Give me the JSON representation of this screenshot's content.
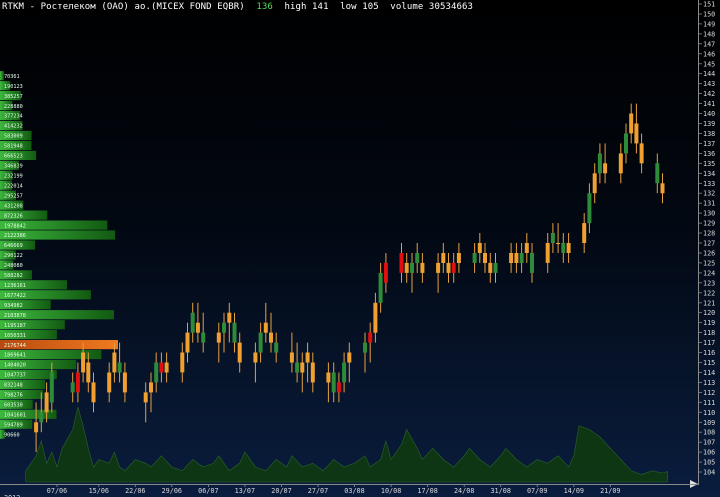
{
  "header": {
    "title": "RTKM - Ростелеком (ОАО) ао.(MICEX FOND EQBR)",
    "last": "136",
    "high": "high 141",
    "low": "low 105",
    "volume": "volume 30534663"
  },
  "colors": {
    "up_candle": "#f0a030",
    "down_candle": "#2e8b3a",
    "signal_candle": "#e01010",
    "profile_bar": "#1f8a1f",
    "profile_max": "#e06010",
    "volume_area": "#0f3a10",
    "axis_text": "#d8d8d8"
  },
  "chart_data": {
    "type": "candlestick",
    "ylim": [
      103,
      151
    ],
    "y_ticks": [
      104,
      105,
      106,
      107,
      108,
      109,
      110,
      111,
      112,
      113,
      114,
      115,
      116,
      117,
      118,
      119,
      120,
      121,
      122,
      123,
      124,
      125,
      126,
      127,
      128,
      129,
      130,
      131,
      132,
      133,
      134,
      135,
      136,
      137,
      138,
      139,
      140,
      141,
      142,
      143,
      144,
      145,
      146,
      147,
      148,
      149,
      150,
      151
    ],
    "x_tick_labels": [
      "07/06",
      "15/06",
      "22/06",
      "29/06",
      "06/07",
      "13/07",
      "20/07",
      "27/07",
      "03/08",
      "10/08",
      "17/08",
      "24/08",
      "31/08",
      "07/09",
      "14/09",
      "21/09"
    ],
    "x_tick_days": [
      0,
      8,
      15,
      22,
      29,
      36,
      43,
      50,
      57,
      64,
      71,
      78,
      85,
      92,
      99,
      106
    ],
    "first_label_partial": "2012",
    "prices": [
      [
        -4,
        108,
        111,
        106,
        109,
        "up"
      ],
      [
        -3,
        109,
        112,
        108,
        110,
        "down"
      ],
      [
        -2,
        110,
        113,
        109,
        112,
        "up"
      ],
      [
        -1,
        111,
        115,
        110,
        114,
        "down"
      ],
      [
        3,
        113,
        114,
        111,
        112,
        "down"
      ],
      [
        4,
        112,
        115,
        111,
        114,
        "signal"
      ],
      [
        5,
        114,
        117,
        113,
        116,
        "up"
      ],
      [
        6,
        115,
        116,
        112,
        113,
        "up"
      ],
      [
        7,
        113,
        114,
        110,
        111,
        "up"
      ],
      [
        10,
        112,
        115,
        111,
        114,
        "up"
      ],
      [
        11,
        114,
        117,
        113,
        116,
        "up"
      ],
      [
        12,
        115,
        117,
        113,
        114,
        "down"
      ],
      [
        13,
        114,
        115,
        111,
        112,
        "up"
      ],
      [
        17,
        111,
        113,
        109,
        112,
        "up"
      ],
      [
        18,
        112,
        114,
        110,
        113,
        "up"
      ],
      [
        19,
        113,
        116,
        112,
        115,
        "down"
      ],
      [
        20,
        114,
        116,
        113,
        115,
        "signal"
      ],
      [
        21,
        115,
        116,
        113,
        114,
        "up"
      ],
      [
        24,
        114,
        117,
        113,
        116,
        "up"
      ],
      [
        25,
        116,
        119,
        115,
        118,
        "up"
      ],
      [
        26,
        118,
        121,
        117,
        120,
        "down"
      ],
      [
        27,
        119,
        121,
        117,
        118,
        "up"
      ],
      [
        28,
        118,
        120,
        116,
        117,
        "down"
      ],
      [
        31,
        117,
        119,
        115,
        118,
        "up"
      ],
      [
        32,
        118,
        120,
        116,
        119,
        "down"
      ],
      [
        33,
        119,
        121,
        117,
        120,
        "up"
      ],
      [
        34,
        119,
        120,
        116,
        117,
        "down"
      ],
      [
        35,
        117,
        118,
        114,
        115,
        "up"
      ],
      [
        38,
        115,
        117,
        113,
        116,
        "up"
      ],
      [
        39,
        116,
        119,
        115,
        118,
        "down"
      ],
      [
        40,
        118,
        121,
        117,
        119,
        "up"
      ],
      [
        41,
        118,
        120,
        116,
        117,
        "up"
      ],
      [
        42,
        117,
        118,
        115,
        116,
        "down"
      ],
      [
        45,
        116,
        118,
        114,
        115,
        "up"
      ],
      [
        46,
        115,
        117,
        113,
        114,
        "down"
      ],
      [
        47,
        114,
        116,
        112,
        115,
        "up"
      ],
      [
        48,
        115,
        117,
        113,
        116,
        "up"
      ],
      [
        49,
        115,
        116,
        112,
        113,
        "up"
      ],
      [
        52,
        113,
        115,
        111,
        114,
        "up"
      ],
      [
        53,
        114,
        115,
        111,
        112,
        "down"
      ],
      [
        54,
        112,
        114,
        111,
        113,
        "signal"
      ],
      [
        55,
        113,
        116,
        112,
        115,
        "down"
      ],
      [
        56,
        115,
        117,
        113,
        116,
        "up"
      ],
      [
        59,
        116,
        118,
        114,
        117,
        "down"
      ],
      [
        60,
        117,
        119,
        115,
        118,
        "signal"
      ],
      [
        61,
        118,
        122,
        117,
        121,
        "up"
      ],
      [
        62,
        121,
        125,
        120,
        124,
        "down"
      ],
      [
        63,
        123,
        126,
        122,
        125,
        "signal"
      ],
      [
        66,
        124,
        127,
        123,
        126,
        "signal"
      ],
      [
        67,
        125,
        126,
        123,
        124,
        "up"
      ],
      [
        68,
        124,
        126,
        122,
        125,
        "down"
      ],
      [
        69,
        125,
        127,
        124,
        126,
        "down"
      ],
      [
        70,
        125,
        126,
        123,
        124,
        "up"
      ],
      [
        73,
        124,
        126,
        122,
        125,
        "up"
      ],
      [
        74,
        125,
        127,
        124,
        126,
        "up"
      ],
      [
        75,
        125,
        126,
        123,
        124,
        "up"
      ],
      [
        76,
        124,
        126,
        123,
        125,
        "signal"
      ],
      [
        77,
        125,
        127,
        124,
        126,
        "up"
      ],
      [
        80,
        125,
        127,
        124,
        126,
        "down"
      ],
      [
        81,
        126,
        128,
        125,
        127,
        "up"
      ],
      [
        82,
        126,
        127,
        124,
        125,
        "up"
      ],
      [
        83,
        125,
        126,
        123,
        124,
        "up"
      ],
      [
        84,
        124,
        126,
        123,
        125,
        "down"
      ],
      [
        87,
        125,
        127,
        124,
        126,
        "up"
      ],
      [
        88,
        126,
        127,
        124,
        125,
        "up"
      ],
      [
        89,
        125,
        127,
        124,
        126,
        "down"
      ],
      [
        90,
        126,
        128,
        125,
        127,
        "up"
      ],
      [
        91,
        126,
        127,
        123,
        124,
        "down"
      ],
      [
        94,
        125,
        128,
        124,
        127,
        "up"
      ],
      [
        95,
        127,
        129,
        126,
        128,
        "down"
      ],
      [
        96,
        127,
        129,
        126,
        127,
        "up"
      ],
      [
        97,
        127,
        128,
        125,
        126,
        "down"
      ],
      [
        98,
        126,
        128,
        125,
        127,
        "up"
      ],
      [
        101,
        127,
        130,
        126,
        129,
        "up"
      ],
      [
        102,
        129,
        133,
        128,
        132,
        "down"
      ],
      [
        103,
        132,
        135,
        131,
        134,
        "up"
      ],
      [
        104,
        134,
        137,
        133,
        136,
        "down"
      ],
      [
        105,
        135,
        137,
        133,
        134,
        "up"
      ],
      [
        108,
        134,
        137,
        133,
        136,
        "up"
      ],
      [
        109,
        136,
        139,
        135,
        138,
        "down"
      ],
      [
        110,
        138,
        141,
        137,
        140,
        "up"
      ],
      [
        111,
        139,
        141,
        136,
        137,
        "up"
      ],
      [
        112,
        137,
        138,
        134,
        135,
        "up"
      ],
      [
        115,
        135,
        136,
        132,
        133,
        "down"
      ],
      [
        116,
        133,
        134,
        131,
        132,
        "up"
      ]
    ],
    "volume_profile": [
      {
        "price": 143.8,
        "label": "70361",
        "value": 70361
      },
      {
        "price": 142.8,
        "label": "190123",
        "value": 190123
      },
      {
        "price": 141.8,
        "label": "385257",
        "value": 385257
      },
      {
        "price": 140.8,
        "label": "228880",
        "value": 228880
      },
      {
        "price": 139.8,
        "label": "377234",
        "value": 377234
      },
      {
        "price": 138.8,
        "label": "414232",
        "value": 414232
      },
      {
        "price": 137.8,
        "label": "583009",
        "value": 583009
      },
      {
        "price": 136.8,
        "label": "581948",
        "value": 581948
      },
      {
        "price": 135.8,
        "label": "666523",
        "value": 666523
      },
      {
        "price": 134.8,
        "label": "346839",
        "value": 346839
      },
      {
        "price": 133.8,
        "label": "232199",
        "value": 232199
      },
      {
        "price": 132.8,
        "label": "222014",
        "value": 222014
      },
      {
        "price": 131.8,
        "label": "295257",
        "value": 295257
      },
      {
        "price": 130.8,
        "label": "431208",
        "value": 431208
      },
      {
        "price": 129.8,
        "label": "872326",
        "value": 872326
      },
      {
        "price": 128.8,
        "label": "1978842",
        "value": 1978842
      },
      {
        "price": 127.8,
        "label": "2122386",
        "value": 2122386
      },
      {
        "price": 126.8,
        "label": "646669",
        "value": 646669
      },
      {
        "price": 125.8,
        "label": "290122",
        "value": 290122
      },
      {
        "price": 124.8,
        "label": "248080",
        "value": 248080
      },
      {
        "price": 123.8,
        "label": "588282",
        "value": 588282
      },
      {
        "price": 122.8,
        "label": "1236161",
        "value": 1236161
      },
      {
        "price": 121.8,
        "label": "1677422",
        "value": 1677422
      },
      {
        "price": 120.8,
        "label": "934982",
        "value": 934982
      },
      {
        "price": 119.8,
        "label": "2103878",
        "value": 2103878
      },
      {
        "price": 118.8,
        "label": "1195187",
        "value": 1195187
      },
      {
        "price": 117.8,
        "label": "1050331",
        "value": 1050331
      },
      {
        "price": 116.8,
        "label": "2176744",
        "value": 2176744,
        "max": true
      },
      {
        "price": 115.8,
        "label": "1869641",
        "value": 1869641
      },
      {
        "price": 114.8,
        "label": "1404020",
        "value": 1404020
      },
      {
        "price": 113.8,
        "label": "1047737",
        "value": 1047737
      },
      {
        "price": 112.8,
        "label": "832148",
        "value": 832148
      },
      {
        "price": 111.8,
        "label": "798276",
        "value": 798276
      },
      {
        "price": 110.8,
        "label": "603530",
        "value": 603530
      },
      {
        "price": 109.8,
        "label": "1041601",
        "value": 1041601
      },
      {
        "price": 108.8,
        "label": "594789",
        "value": 594789
      },
      {
        "price": 107.8,
        "label": "90660",
        "value": 90660
      }
    ],
    "volume_series": [
      [
        -6,
        0.15
      ],
      [
        -4,
        0.35
      ],
      [
        -3,
        0.55
      ],
      [
        -2,
        0.25
      ],
      [
        -1,
        0.4
      ],
      [
        0,
        0.2
      ],
      [
        1,
        0.45
      ],
      [
        3,
        0.7
      ],
      [
        4,
        1.0
      ],
      [
        5,
        0.75
      ],
      [
        6,
        0.45
      ],
      [
        7,
        0.2
      ],
      [
        8,
        0.3
      ],
      [
        10,
        0.25
      ],
      [
        11,
        0.4
      ],
      [
        12,
        0.2
      ],
      [
        13,
        0.15
      ],
      [
        15,
        0.3
      ],
      [
        17,
        0.25
      ],
      [
        18,
        0.2
      ],
      [
        20,
        0.35
      ],
      [
        22,
        0.2
      ],
      [
        24,
        0.15
      ],
      [
        26,
        0.3
      ],
      [
        28,
        0.2
      ],
      [
        30,
        0.25
      ],
      [
        31,
        0.35
      ],
      [
        33,
        0.15
      ],
      [
        35,
        0.25
      ],
      [
        36,
        0.4
      ],
      [
        38,
        0.2
      ],
      [
        40,
        0.15
      ],
      [
        42,
        0.3
      ],
      [
        44,
        0.2
      ],
      [
        45,
        0.35
      ],
      [
        47,
        0.2
      ],
      [
        49,
        0.25
      ],
      [
        51,
        0.15
      ],
      [
        53,
        0.3
      ],
      [
        55,
        0.2
      ],
      [
        57,
        0.25
      ],
      [
        59,
        0.35
      ],
      [
        60,
        0.2
      ],
      [
        62,
        0.3
      ],
      [
        63,
        0.55
      ],
      [
        64,
        0.3
      ],
      [
        66,
        0.5
      ],
      [
        67,
        0.7
      ],
      [
        69,
        0.45
      ],
      [
        70,
        0.3
      ],
      [
        72,
        0.45
      ],
      [
        74,
        0.3
      ],
      [
        76,
        0.2
      ],
      [
        78,
        0.35
      ],
      [
        79,
        0.45
      ],
      [
        81,
        0.3
      ],
      [
        83,
        0.2
      ],
      [
        85,
        0.35
      ],
      [
        86,
        0.45
      ],
      [
        88,
        0.3
      ],
      [
        90,
        0.2
      ],
      [
        92,
        0.3
      ],
      [
        94,
        0.25
      ],
      [
        96,
        0.35
      ],
      [
        98,
        0.2
      ],
      [
        99,
        0.35
      ],
      [
        100,
        0.75
      ],
      [
        102,
        0.7
      ],
      [
        104,
        0.6
      ],
      [
        106,
        0.45
      ],
      [
        108,
        0.3
      ],
      [
        110,
        0.15
      ],
      [
        112,
        0.1
      ],
      [
        114,
        0.15
      ],
      [
        116,
        0.12
      ],
      [
        117,
        0.14
      ]
    ]
  }
}
